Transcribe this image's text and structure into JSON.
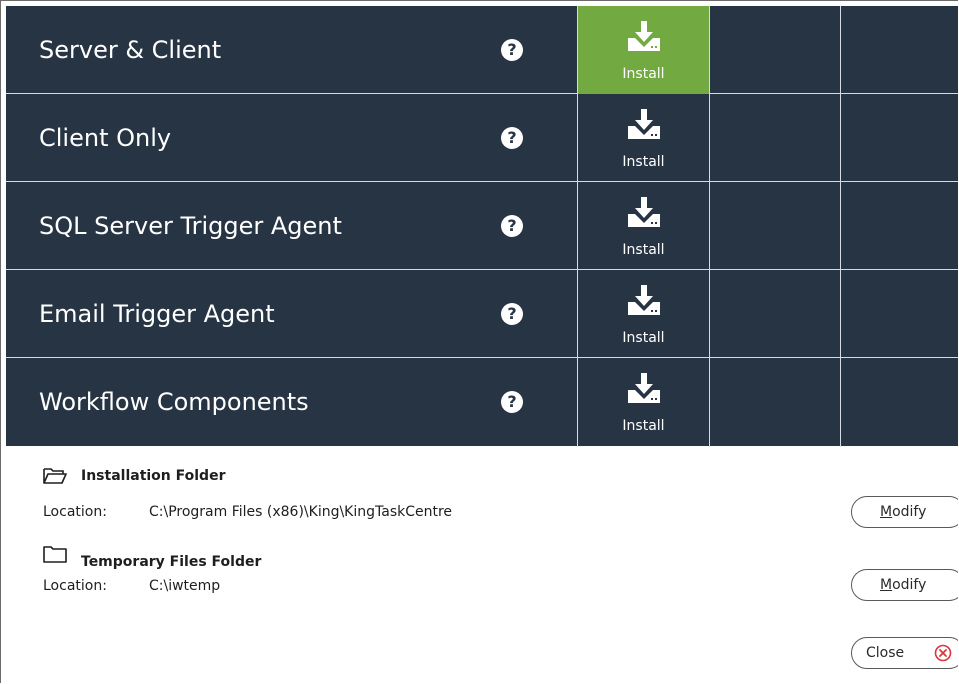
{
  "components": [
    {
      "name": "Server & Client",
      "action": "Install",
      "selected": true
    },
    {
      "name": "Client Only",
      "action": "Install",
      "selected": false
    },
    {
      "name": "SQL Server Trigger Agent",
      "action": "Install",
      "selected": false
    },
    {
      "name": "Email Trigger Agent",
      "action": "Install",
      "selected": false
    },
    {
      "name": "Workflow Components",
      "action": "Install",
      "selected": false
    }
  ],
  "help_icon": "?",
  "installation_folder": {
    "title": "Installation Folder",
    "location_label": "Location:",
    "location_value": "C:\\Program Files (x86)\\King\\KingTaskCentre",
    "modify_underlined": "M",
    "modify_rest": "odify"
  },
  "temporary_folder": {
    "title": "Temporary Files Folder",
    "location_label": "Location:",
    "location_value": "C:\\iwtemp",
    "modify_underlined": "M",
    "modify_rest": "odify"
  },
  "close_label": "Close",
  "colors": {
    "panel": "#273444",
    "selected": "#72a940",
    "divider": "#d5dbe2",
    "close_icon": "#d9363e"
  },
  "icons": [
    "download-icon",
    "help-icon",
    "folder-open-icon",
    "folder-icon",
    "close-circle-icon"
  ]
}
